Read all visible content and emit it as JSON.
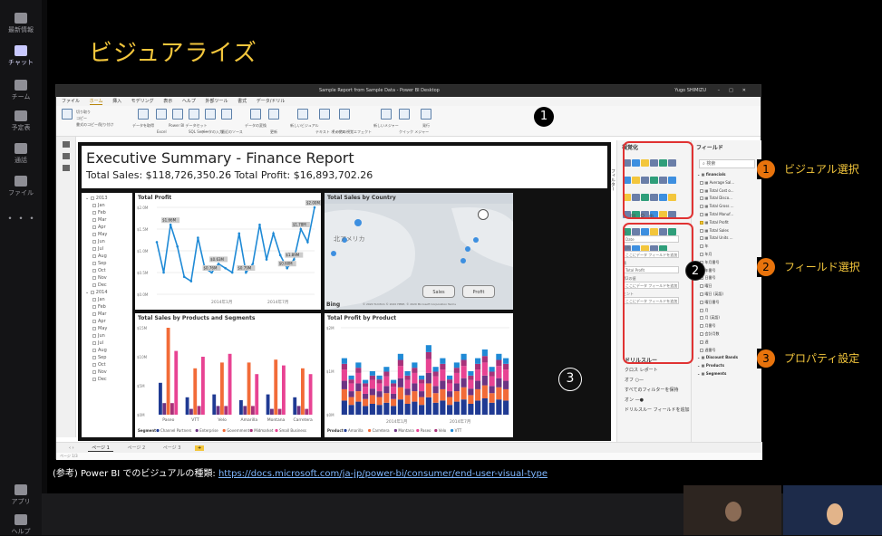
{
  "rail": {
    "items": [
      "最新情報",
      "チャット",
      "チーム",
      "予定表",
      "通話",
      "ファイル"
    ],
    "bottom": [
      "アプリ",
      "ヘルプ"
    ],
    "more": "・・・"
  },
  "slide": {
    "title": "ビジュアライズ",
    "reference_prefix": "(参考) Power BI でのビジュアルの種類: ",
    "reference_link": "https://docs.microsoft.com/ja-jp/power-bi/consumer/end-user-visual-type"
  },
  "pbi": {
    "window_title": "Sample Report from Sample Data - Power BI Desktop",
    "user": "Yugo SHIMIZU",
    "menu": [
      "ファイル",
      "ホーム",
      "挿入",
      "モデリング",
      "表示",
      "ヘルプ",
      "外部ツール",
      "書式",
      "データ/ドリル"
    ],
    "ribbon": [
      "切り取り",
      "コピー",
      "書式のコピー/貼り付け",
      "データを取得",
      "Excel",
      "Power BI データセット",
      "SQL Server",
      "データの入力",
      "最近のソース",
      "データの変換",
      "更新",
      "新しいビジュアル",
      "テキスト ボックス",
      "その他の視覚エフェクト",
      "新しいメジャー",
      "クイック メジャー",
      "発行"
    ],
    "report_title": "Executive Summary - Finance Report",
    "report_subtitle": "Total Sales: $118,726,350.26 Total Profit: $16,893,702.26",
    "slicer": {
      "years": [
        "2013",
        "2014"
      ],
      "months": [
        "Jan",
        "Feb",
        "Mar",
        "Apr",
        "May",
        "Jun",
        "Jul",
        "Aug",
        "Sep",
        "Oct",
        "Nov",
        "Dec"
      ]
    },
    "visuals": {
      "profit_title": "Total Profit",
      "country_title": "Total Sales by Country",
      "segments_title": "Total Sales by Products and Segments",
      "product_title": "Total Profit by Product"
    },
    "map": {
      "label": "北アメリカ",
      "sales_btn": "Sales",
      "profit_btn": "Profit",
      "attribution": "© 2020 TomTom © 2020 HERE, © 2020 Microsoft Corporation Terms",
      "bing": "Bing"
    },
    "viz_pane": {
      "title": "視覚化",
      "values_label": "軸",
      "axis_value": "Date",
      "legend_label": "凡例",
      "legend_value": "ここにデータ フィールドを追加",
      "val_label": "値",
      "val_value": "Total Profit",
      "secondary_label": "第2の値",
      "secondary_value": "ここにデータ フィールドを追加",
      "tooltip_label": "ヒント",
      "tooltip_value": "ここにデータ フィールドを追加",
      "drill_title": "ドリルスルー",
      "cross_report": "クロス レポート",
      "off": "オフ",
      "keep_filters": "すべてのフィルターを保持",
      "on": "オン",
      "drill_add": "ドリルスルー フィールドを追加"
    },
    "filter_tab": "フィルター",
    "fields_pane": {
      "title": "フィールド",
      "search": "検索",
      "table": "financials",
      "fields": [
        {
          "name": "Average Sal...",
          "checked": false
        },
        {
          "name": "Total Cost o...",
          "checked": false
        },
        {
          "name": "Total Disco...",
          "checked": false
        },
        {
          "name": "Total Gross ...",
          "checked": false
        },
        {
          "name": "Total Manuf...",
          "checked": false
        },
        {
          "name": "Total Profit",
          "checked": true
        },
        {
          "name": "Total Sales",
          "checked": false
        },
        {
          "name": "Total Units ...",
          "checked": false
        }
      ],
      "date_fields": [
        "年",
        "年月",
        "年月番号",
        "年番号",
        "日番号",
        "曜日",
        "曜日 (英語)",
        "曜日番号",
        "月",
        "月 (英語)",
        "月番号",
        "会計月数",
        "週",
        "週番号"
      ],
      "groups": [
        "Discount Bands",
        "Products",
        "Segments"
      ]
    },
    "pages": [
      "ページ 1",
      "ページ 2",
      "ページ 3",
      "+"
    ],
    "status": "ページ 1/3"
  },
  "annotations": {
    "num1": "1",
    "num2": "2",
    "num3": "3",
    "callouts": [
      {
        "n": "1",
        "label": "ビジュアル選択"
      },
      {
        "n": "2",
        "label": "フィールド選択"
      },
      {
        "n": "3",
        "label": "プロパティ設定"
      }
    ]
  },
  "chart_data": [
    {
      "type": "line",
      "title": "Total Profit",
      "ylim": [
        0,
        2000000
      ],
      "yticks": [
        "$0.0M",
        "$0.5M",
        "$1.0M",
        "$1.5M",
        "$2.0M"
      ],
      "xticks": [
        "2014年1月",
        "2014年7月"
      ],
      "series": [
        {
          "values": [
            1.2,
            0.5,
            1.6,
            1.1,
            0.4,
            0.3,
            1.3,
            0.6,
            0.5,
            0.7,
            0.6,
            0.5,
            1.4,
            0.5,
            0.7,
            1.6,
            0.8,
            1.4,
            0.9,
            0.6,
            0.8,
            1.5,
            1.2,
            2.0
          ]
        }
      ],
      "data_labels": [
        "$1.66M",
        "$0.76M",
        "$0.63M",
        "$0.79M",
        "$0.60M",
        "$1.78M",
        "$1.89M",
        "$2.00M"
      ],
      "color": "#1f8ad6"
    },
    {
      "type": "bar",
      "title": "Total Sales by Products and Segments",
      "categories": [
        "Paseo",
        "VTT",
        "Velo",
        "Amarilla",
        "Montana",
        "Carretera"
      ],
      "yticks": [
        "$0M",
        "$5M",
        "$10M",
        "$15M"
      ],
      "legend_title": "Segment",
      "series": [
        {
          "name": "Channel Partners",
          "color": "#1f3a93",
          "values": [
            5.5,
            3.0,
            3.5,
            2.5,
            3.5,
            3.0
          ]
        },
        {
          "name": "Enterprise",
          "color": "#6c3483",
          "values": [
            2.0,
            1.0,
            1.5,
            1.5,
            1.0,
            1.5
          ]
        },
        {
          "name": "Government",
          "color": "#f26b38",
          "values": [
            15.0,
            8.0,
            9.0,
            9.0,
            9.5,
            8.0
          ]
        },
        {
          "name": "Midmarket",
          "color": "#a83279",
          "values": [
            2.0,
            1.5,
            1.5,
            1.5,
            1.0,
            1.0
          ]
        },
        {
          "name": "Small Business",
          "color": "#e84393",
          "values": [
            11.0,
            10.0,
            10.5,
            7.0,
            8.5,
            7.0
          ]
        }
      ]
    },
    {
      "type": "bar",
      "title": "Total Profit by Product",
      "yticks": [
        "$0M",
        "$1M",
        "$2M"
      ],
      "xticks": [
        "2014年1月",
        "2014年7月"
      ],
      "legend_title": "Product",
      "series": [
        {
          "name": "Amarilla",
          "color": "#1f3a93"
        },
        {
          "name": "Carretera",
          "color": "#f26b38"
        },
        {
          "name": "Montana",
          "color": "#6c3483"
        },
        {
          "name": "Paseo",
          "color": "#e84393"
        },
        {
          "name": "Velo",
          "color": "#a83279"
        },
        {
          "name": "VTT",
          "color": "#1f8ad6"
        }
      ],
      "stack_totals": [
        1.3,
        0.9,
        1.2,
        0.8,
        1.0,
        0.9,
        1.1,
        0.8,
        1.4,
        1.0,
        1.2,
        0.9,
        1.6,
        1.1,
        1.3,
        0.9,
        1.2,
        1.4,
        1.0,
        1.3,
        1.5,
        1.1,
        1.4,
        1.3
      ]
    }
  ]
}
